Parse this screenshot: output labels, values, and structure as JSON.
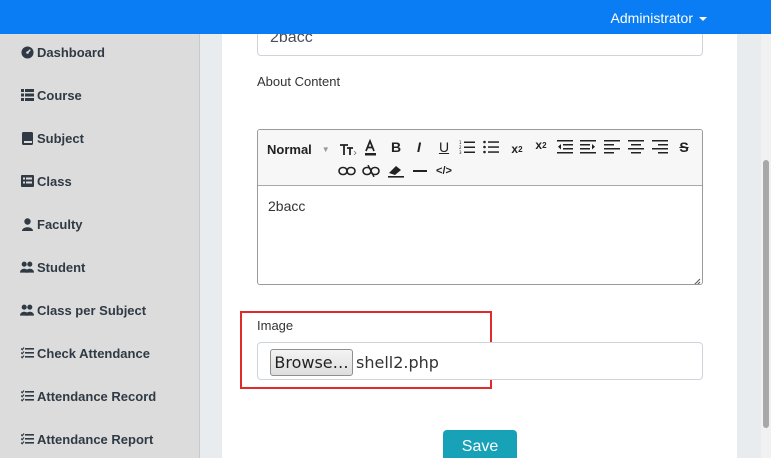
{
  "header": {
    "user_menu": "Administrator"
  },
  "sidebar": {
    "items": [
      {
        "label": "Dashboard",
        "icon": "dashboard-icon"
      },
      {
        "label": "Course",
        "icon": "list-icon"
      },
      {
        "label": "Subject",
        "icon": "book-icon"
      },
      {
        "label": "Class",
        "icon": "list-alt-icon"
      },
      {
        "label": "Faculty",
        "icon": "user-tie-icon"
      },
      {
        "label": "Student",
        "icon": "users-icon"
      },
      {
        "label": "Class per Subject",
        "icon": "users-icon"
      },
      {
        "label": "Check Attendance",
        "icon": "tasks-icon"
      },
      {
        "label": "Attendance Record",
        "icon": "tasks-icon"
      },
      {
        "label": "Attendance Report",
        "icon": "tasks-icon"
      }
    ]
  },
  "form": {
    "title_value": "2bacc",
    "about_label": "About Content",
    "editor": {
      "format_select": "Normal",
      "content": "2bacc"
    },
    "image_label": "Image",
    "browse_label": "Browse…",
    "file_name": "shell2.php",
    "save_label": "Save"
  },
  "colors": {
    "topbar": "#0a7df5",
    "highlight_box": "#e02b2b",
    "save_button": "#17a2b8"
  }
}
